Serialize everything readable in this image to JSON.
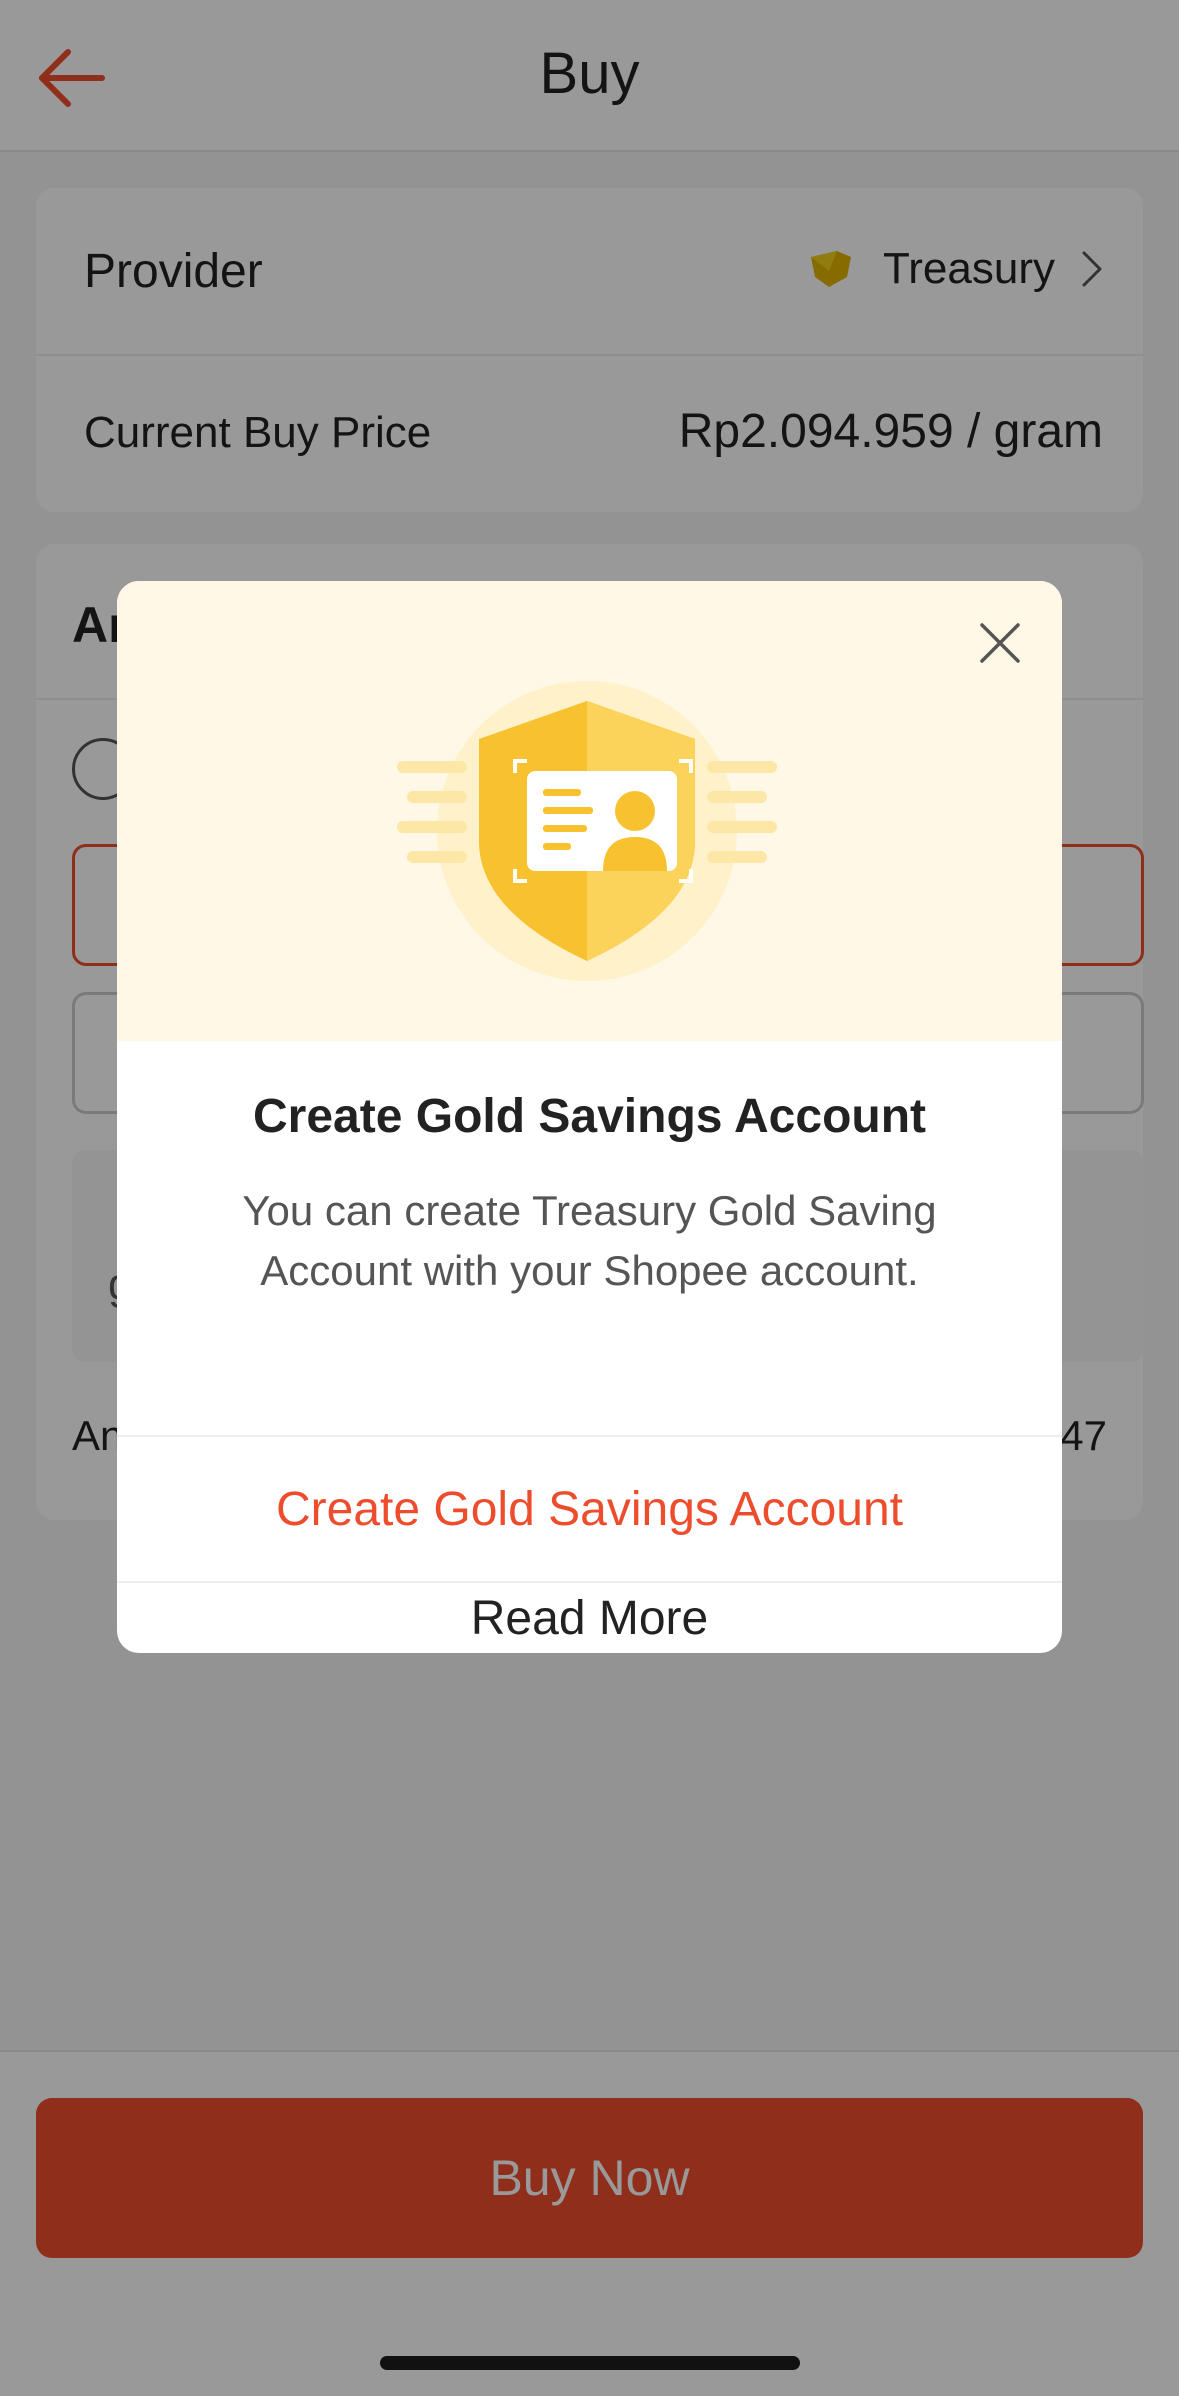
{
  "header": {
    "title": "Buy",
    "back_icon": "arrow-left-icon",
    "accent_color": "#ee4d2d"
  },
  "provider_card": {
    "provider_label": "Provider",
    "provider_name": "Treasury",
    "provider_logo_icon": "treasury-logo-icon",
    "chevron_icon": "chevron-right-icon",
    "price_label": "Current Buy Price",
    "price_value": "Rp2.094.959 / gram"
  },
  "amount_card": {
    "title_partial": "An",
    "amount_label_partial": "An",
    "amount_value_partial": "47",
    "info_partial": "g"
  },
  "bottom_bar": {
    "buy_now_label": "Buy Now"
  },
  "modal": {
    "close_icon": "close-icon",
    "illustration_icon": "shield-id-card-icon",
    "title": "Create Gold Savings Account",
    "description": "You can create Treasury Gold Saving Account with your Shopee account.",
    "primary_action": "Create Gold Savings Account",
    "secondary_action": "Read More"
  }
}
